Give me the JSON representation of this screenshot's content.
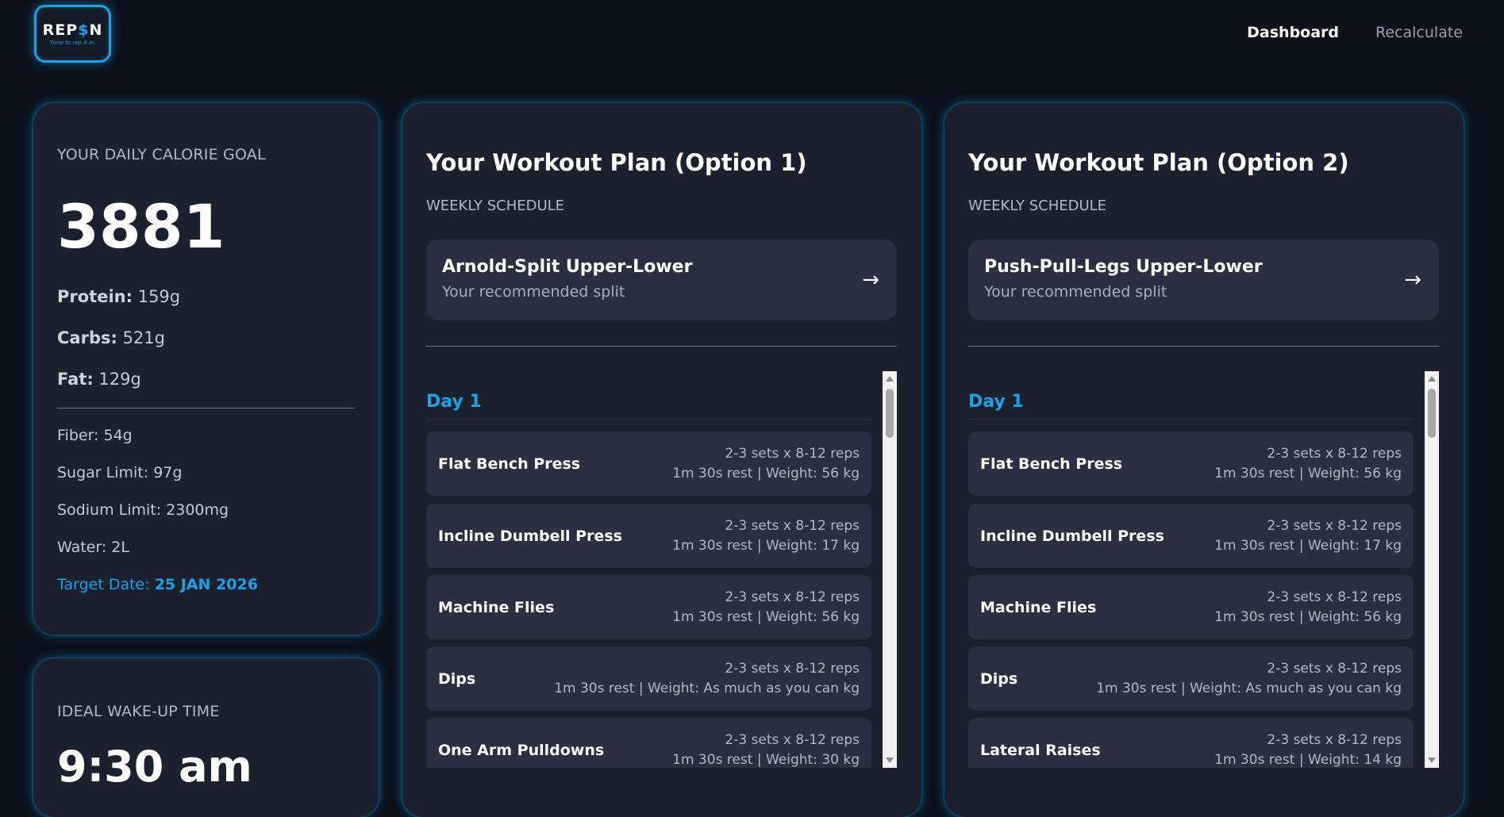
{
  "header": {
    "logo_word_start": "REP",
    "logo_word_accent": "$",
    "logo_word_end": "N",
    "logo_tagline": "Time to rep it in.",
    "nav": [
      {
        "label": "Dashboard",
        "active": true
      },
      {
        "label": "Recalculate",
        "active": false
      }
    ]
  },
  "calorie_card": {
    "label": "YOUR DAILY CALORIE GOAL",
    "calories": "3881",
    "protein_label": "Protein:",
    "protein_value": "159g",
    "carbs_label": "Carbs:",
    "carbs_value": "521g",
    "fat_label": "Fat:",
    "fat_value": "129g",
    "fiber": "Fiber: 54g",
    "sugar": "Sugar Limit: 97g",
    "sodium": "Sodium Limit: 2300mg",
    "water": "Water: 2L",
    "target_label": "Target Date:",
    "target_value": "25 JAN 2026"
  },
  "wake_card": {
    "label": "IDEAL WAKE-UP TIME",
    "time": "9:30 am"
  },
  "plans": [
    {
      "title": "Your Workout Plan (Option 1)",
      "subtitle": "WEEKLY SCHEDULE",
      "split_name": "Arnold-Split Upper-Lower",
      "split_desc": "Your recommended split",
      "arrow": "→",
      "day": "Day 1",
      "exercises": [
        {
          "name": "Flat Bench Press",
          "sets": "2-3 sets x 8-12 reps",
          "rest": "1m 30s rest | Weight: 56 kg"
        },
        {
          "name": "Incline Dumbell Press",
          "sets": "2-3 sets x 8-12 reps",
          "rest": "1m 30s rest | Weight: 17 kg"
        },
        {
          "name": "Machine Flies",
          "sets": "2-3 sets x 8-12 reps",
          "rest": "1m 30s rest | Weight: 56 kg"
        },
        {
          "name": "Dips",
          "sets": "2-3 sets x 8-12 reps",
          "rest": "1m 30s rest | Weight: As much as you can kg"
        },
        {
          "name": "One Arm Pulldowns",
          "sets": "2-3 sets x 8-12 reps",
          "rest": "1m 30s rest | Weight: 30 kg"
        }
      ]
    },
    {
      "title": "Your Workout Plan (Option 2)",
      "subtitle": "WEEKLY SCHEDULE",
      "split_name": "Push-Pull-Legs Upper-Lower",
      "split_desc": "Your recommended split",
      "arrow": "→",
      "day": "Day 1",
      "exercises": [
        {
          "name": "Flat Bench Press",
          "sets": "2-3 sets x 8-12 reps",
          "rest": "1m 30s rest | Weight: 56 kg"
        },
        {
          "name": "Incline Dumbell Press",
          "sets": "2-3 sets x 8-12 reps",
          "rest": "1m 30s rest | Weight: 17 kg"
        },
        {
          "name": "Machine Flies",
          "sets": "2-3 sets x 8-12 reps",
          "rest": "1m 30s rest | Weight: 56 kg"
        },
        {
          "name": "Dips",
          "sets": "2-3 sets x 8-12 reps",
          "rest": "1m 30s rest | Weight: As much as you can kg"
        },
        {
          "name": "Lateral Raises",
          "sets": "2-3 sets x 8-12 reps",
          "rest": "1m 30s rest | Weight: 14 kg"
        }
      ]
    }
  ],
  "colors": {
    "background": "#0c111b",
    "card": "#1c2130",
    "accent": "#1aa3e8",
    "item": "#2a3042"
  }
}
